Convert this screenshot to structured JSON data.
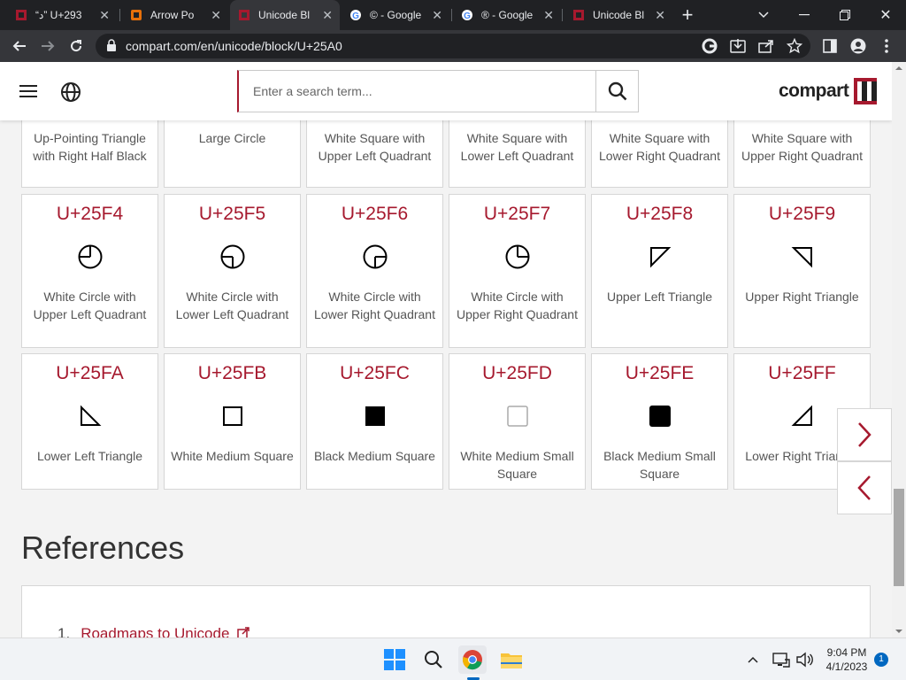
{
  "browser": {
    "tabs": [
      {
        "title": "“د” U+293",
        "icon": "compart-icon"
      },
      {
        "title": "Arrow Po",
        "icon": "compart-icon"
      },
      {
        "title": "Unicode Bl",
        "icon": "compart-icon",
        "active": true
      },
      {
        "title": "© - Google",
        "icon": "google-icon"
      },
      {
        "title": "® - Google",
        "icon": "google-icon"
      },
      {
        "title": "Unicode Bl",
        "icon": "compart-icon"
      }
    ],
    "new_tab": "+",
    "url": "compart.com/en/unicode/block/U+25A0"
  },
  "site": {
    "search_placeholder": "Enter a search term...",
    "logo_text": "compart"
  },
  "cards": [
    {
      "code": "",
      "name": "Up-Pointing Triangle with Right Half Black",
      "glyph": "none"
    },
    {
      "code": "",
      "name": "Large Circle",
      "glyph": "none"
    },
    {
      "code": "",
      "name": "White Square with Upper Left Quadrant",
      "glyph": "none"
    },
    {
      "code": "",
      "name": "White Square with Lower Left Quadrant",
      "glyph": "none"
    },
    {
      "code": "",
      "name": "White Square with Lower Right Quadrant",
      "glyph": "none"
    },
    {
      "code": "",
      "name": "White Square with Upper Right Quadrant",
      "glyph": "none"
    },
    {
      "code": "U+25F4",
      "name": "White Circle with Upper Left Quadrant",
      "glyph": "circle-upper-left"
    },
    {
      "code": "U+25F5",
      "name": "White Circle with Lower Left Quadrant",
      "glyph": "circle-lower-left"
    },
    {
      "code": "U+25F6",
      "name": "White Circle with Lower Right Quadrant",
      "glyph": "circle-lower-right"
    },
    {
      "code": "U+25F7",
      "name": "White Circle with Upper Right Quadrant",
      "glyph": "circle-upper-right"
    },
    {
      "code": "U+25F8",
      "name": "Upper Left Triangle",
      "glyph": "triangle-upper-left"
    },
    {
      "code": "U+25F9",
      "name": "Upper Right Triangle",
      "glyph": "triangle-upper-right"
    },
    {
      "code": "U+25FA",
      "name": "Lower Left Triangle",
      "glyph": "triangle-lower-left"
    },
    {
      "code": "U+25FB",
      "name": "White Medium Square",
      "glyph": "white-medium-square"
    },
    {
      "code": "U+25FC",
      "name": "Black Medium Square",
      "glyph": "black-medium-square"
    },
    {
      "code": "U+25FD",
      "name": "White Medium Small Square",
      "glyph": "white-medium-small-square"
    },
    {
      "code": "U+25FE",
      "name": "Black Medium Small Square",
      "glyph": "black-medium-small-square"
    },
    {
      "code": "U+25FF",
      "name": "Lower Right Triangle",
      "glyph": "triangle-lower-right"
    }
  ],
  "references": {
    "heading": "References",
    "items": [
      {
        "number": "1.",
        "label": "Roadmaps to Unicode"
      }
    ]
  },
  "taskbar": {
    "time": "9:04 PM",
    "date": "4/1/2023",
    "notification_count": "1"
  },
  "colors": {
    "accent": "#a6192e",
    "chrome_dark": "#202124",
    "chrome_toolbar": "#35363a"
  }
}
